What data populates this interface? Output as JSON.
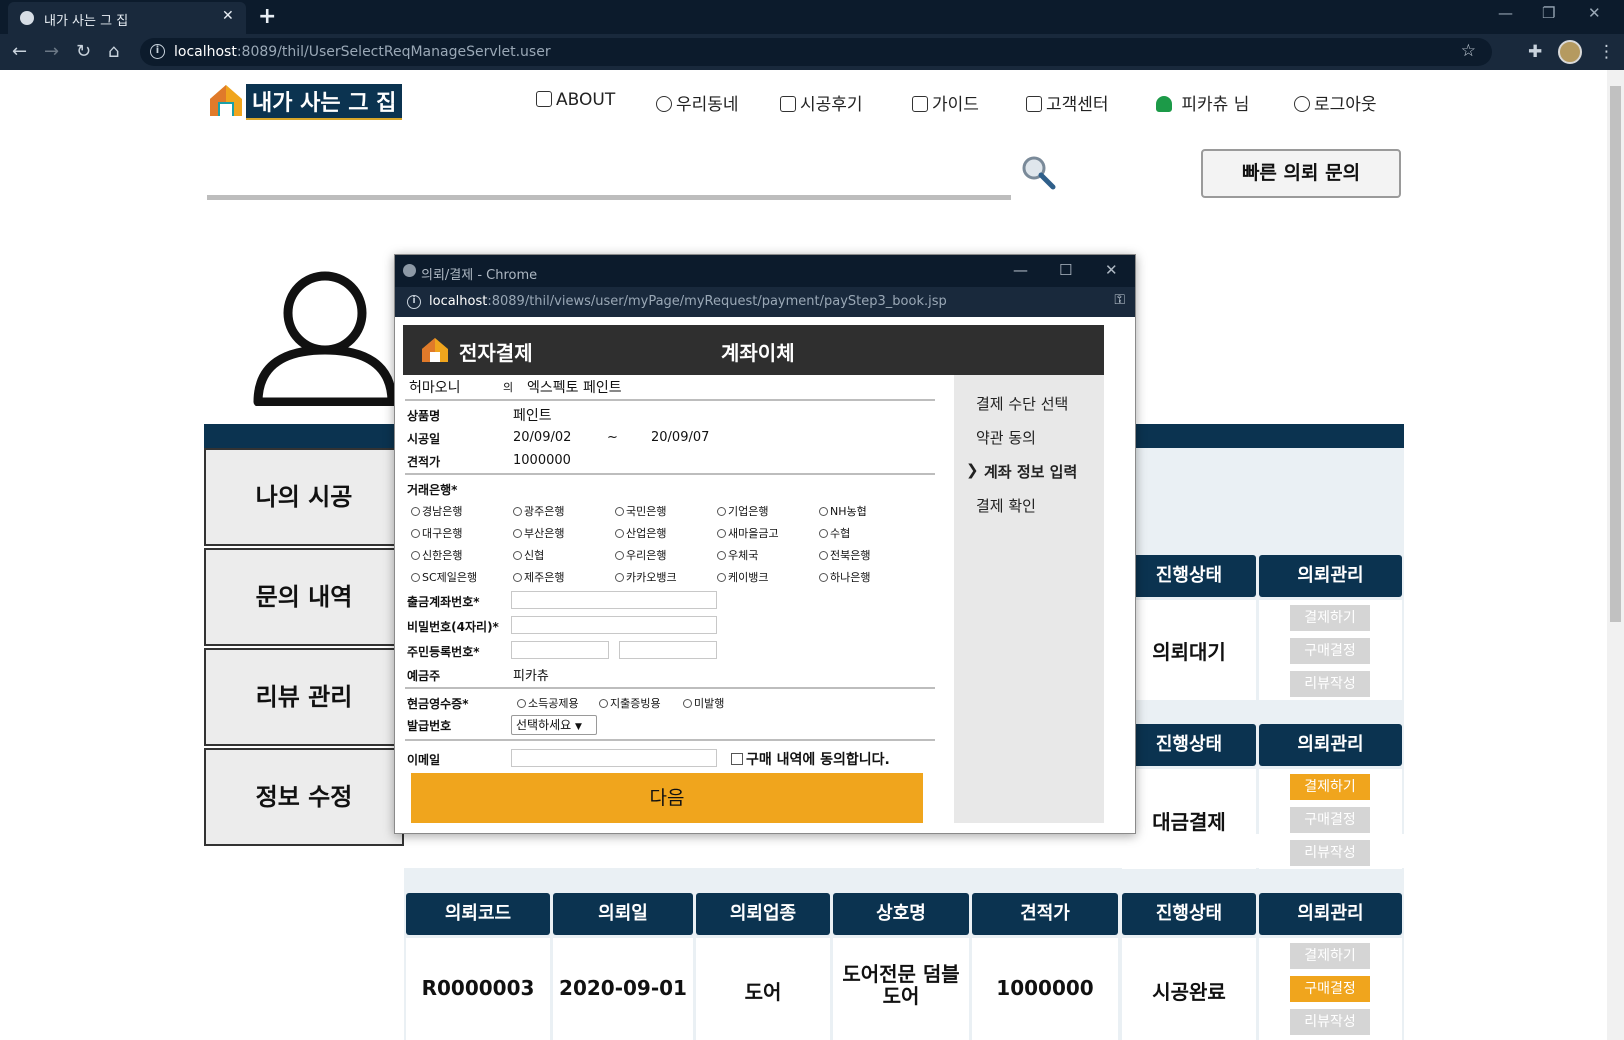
{
  "browser": {
    "tab_title": "내가 사는 그 집",
    "url_host": "localhost",
    "url_rest": ":8089/thil/UserSelectReqManageServlet.user"
  },
  "site": {
    "logo_text": "내가 사는 그 집",
    "nav": [
      "ABOUT",
      "우리동네",
      "시공후기",
      "가이드",
      "고객센터",
      "피카츄 님",
      "로그아웃"
    ],
    "quick_button": "빠른 의뢰 문의"
  },
  "sidebar": {
    "items": [
      "나의 시공",
      "문의 내역",
      "리뷰 관리",
      "정보 수정"
    ]
  },
  "table": {
    "headers": [
      "의뢰코드",
      "의뢰일",
      "의뢰업종",
      "상호명",
      "견적가",
      "진행상태",
      "의뢰관리"
    ],
    "actions": [
      "결제하기",
      "구매결정",
      "리뷰작성"
    ],
    "rows": [
      {
        "status": "의뢰대기",
        "active_action": ""
      },
      {
        "status": "대금결제",
        "active_action": "결제하기"
      },
      {
        "code": "R0000003",
        "date": "2020-09-01",
        "category": "도어",
        "company": "도어전문 덤블도어",
        "price": "1000000",
        "status": "시공완료",
        "active_action": "구매결정"
      }
    ]
  },
  "popup": {
    "window_title": "의뢰/결제 - Chrome",
    "url_host": "localhost",
    "url_rest": ":8089/thil/views/user/myPage/myRequest/payment/payStep3_book.jsp",
    "header_left": "전자결제",
    "header_center": "계좌이체",
    "steps": [
      "결제 수단 선택",
      "약관 동의",
      "계좌 정보 입력",
      "결제 확인"
    ],
    "current_step": 2,
    "buyer": "허마오니",
    "buyer_suffix": "의",
    "seller": "엑스펙토 페인트",
    "fields": {
      "product_label": "상품명",
      "product": "페인트",
      "period_label": "시공일",
      "start": "20/09/02",
      "tilde": "~",
      "end": "20/09/07",
      "estimate_label": "견적가",
      "estimate": "1000000",
      "bank_label": "거래은행*",
      "account_label": "출금계좌번호*",
      "password_label": "비밀번호(4자리)*",
      "rrn_label": "주민등록번호*",
      "holder_label": "예금주",
      "holder": "피카츄",
      "receipt_label": "현금영수증*",
      "issue_label": "발급번호",
      "issue_select": "선택하세요",
      "email_label": "이메일",
      "agree": "구매 내역에 동의합니다."
    },
    "banks": [
      [
        "경남은행",
        "광주은행",
        "국민은행",
        "기업은행",
        "NH농협"
      ],
      [
        "대구은행",
        "부산은행",
        "산업은행",
        "새마을금고",
        "수협"
      ],
      [
        "신한은행",
        "신협",
        "우리은행",
        "우체국",
        "전북은행"
      ],
      [
        "SC제일은행",
        "제주은행",
        "카카오뱅크",
        "케이뱅크",
        "하나은행"
      ]
    ],
    "receipt_options": [
      "소득공제용",
      "지출증빙용",
      "미발행"
    ],
    "next_button": "다음"
  },
  "colors": {
    "navy": "#0b3350",
    "orange": "#f0a51d",
    "chrome_dark": "#0c1b2c"
  }
}
